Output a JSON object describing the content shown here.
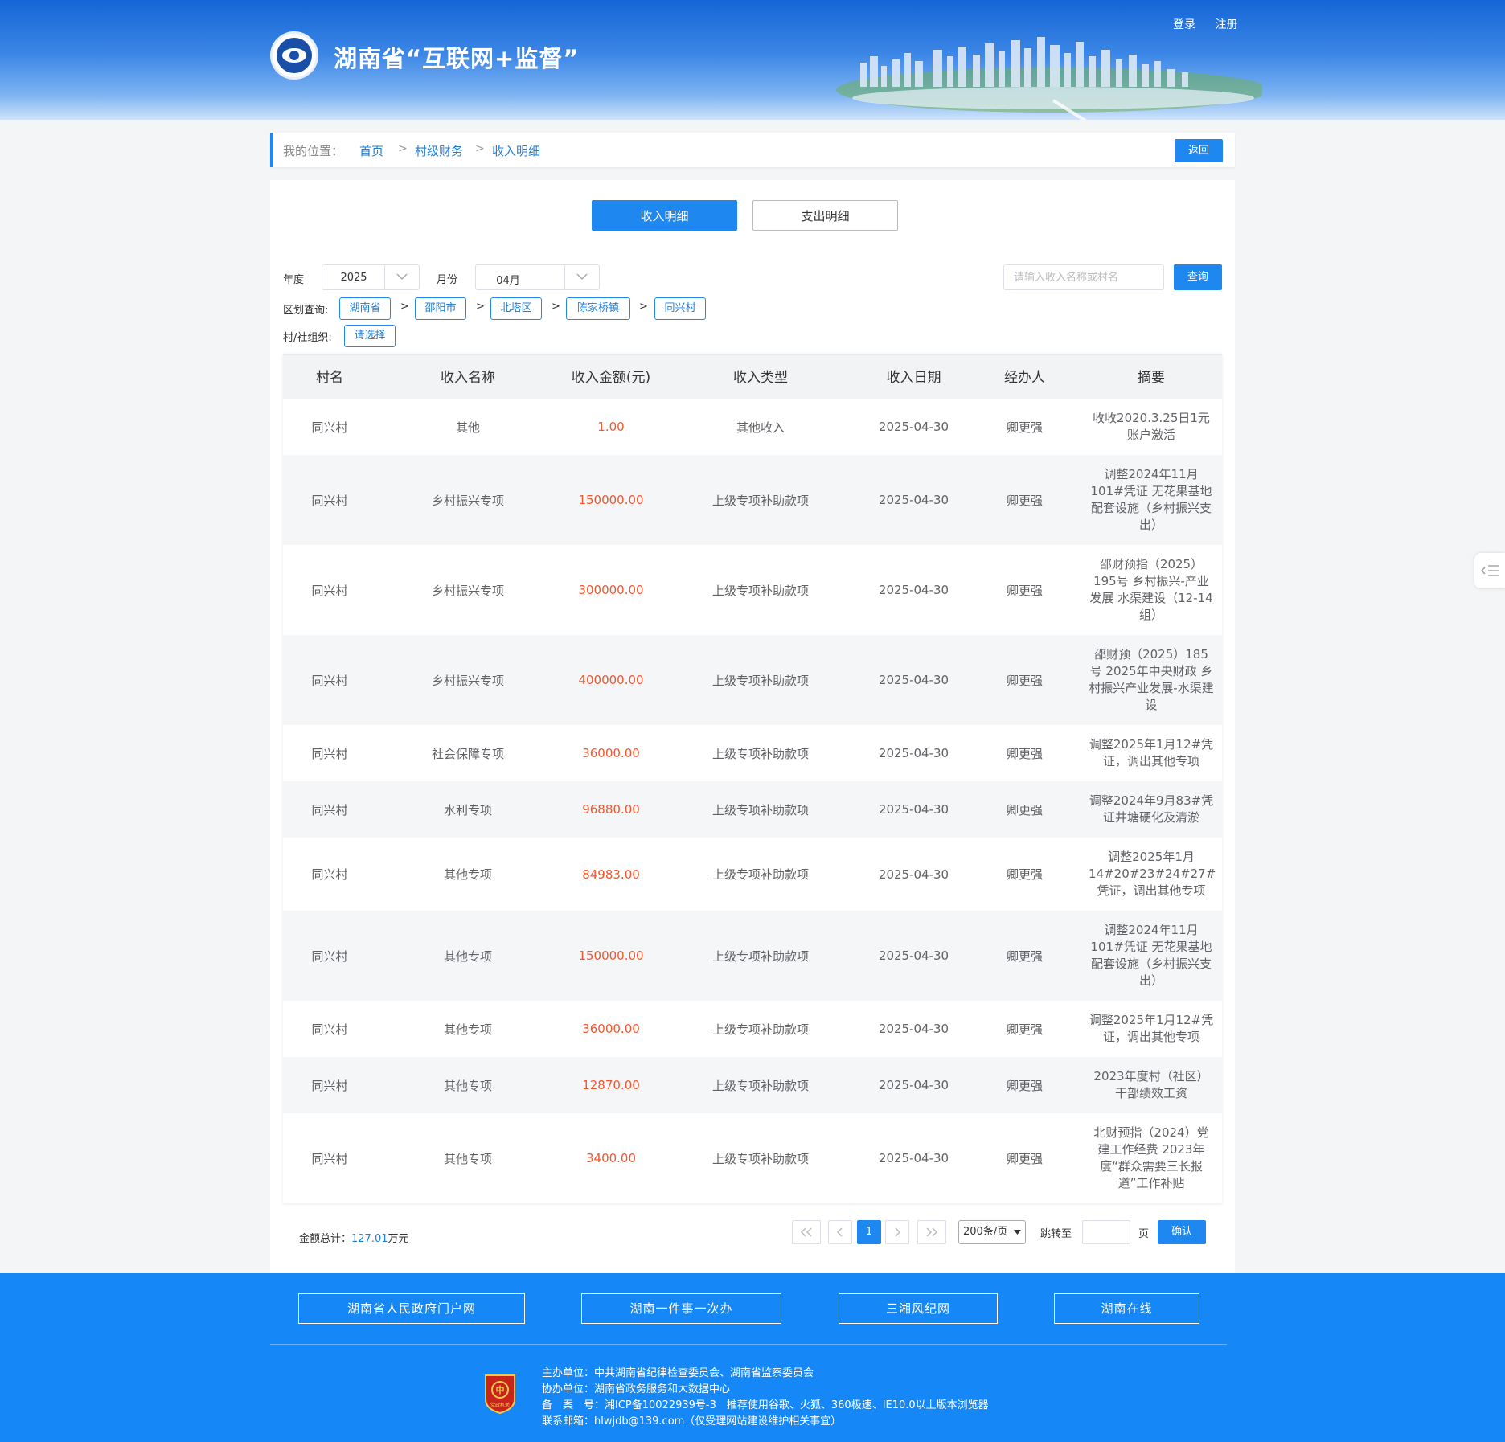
{
  "header": {
    "site_title": "湖南省“互联网+监督”",
    "login": "登录",
    "register": "注册"
  },
  "breadcrumb": {
    "label": "我的位置：",
    "items": [
      "首页",
      "村级财务",
      "收入明细"
    ],
    "separator": ">",
    "back_label": "返回"
  },
  "tabs": [
    {
      "label": "收入明细",
      "active": true
    },
    {
      "label": "支出明细",
      "active": false
    }
  ],
  "filters": {
    "year_label": "年度",
    "year_value": "2025",
    "month_label": "月份",
    "month_value": "04月",
    "search_placeholder": "请输入收入名称或村名",
    "query_label": "查询",
    "region_label": "区划查询:",
    "regions": [
      "湖南省",
      "邵阳市",
      "北塔区",
      "陈家桥镇",
      "同兴村"
    ],
    "region_separator": ">",
    "org_label": "村/社组织:",
    "org_value": "请选择"
  },
  "table": {
    "headers": [
      "村名",
      "收入名称",
      "收入金额(元)",
      "收入类型",
      "收入日期",
      "经办人",
      "摘要"
    ],
    "rows": [
      {
        "village": "同兴村",
        "name": "其他",
        "amount": "1.00",
        "type": "其他收入",
        "date": "2025-04-30",
        "handler": "卿更强",
        "summary": "收收2020.3.25日1元账户激活"
      },
      {
        "village": "同兴村",
        "name": "乡村振兴专项",
        "amount": "150000.00",
        "type": "上级专项补助款项",
        "date": "2025-04-30",
        "handler": "卿更强",
        "summary": "调整2024年11月101#凭证 无花果基地配套设施（乡村振兴支出）"
      },
      {
        "village": "同兴村",
        "name": "乡村振兴专项",
        "amount": "300000.00",
        "type": "上级专项补助款项",
        "date": "2025-04-30",
        "handler": "卿更强",
        "summary": "邵财预指（2025）195号 乡村振兴-产业发展 水渠建设（12-14组）"
      },
      {
        "village": "同兴村",
        "name": "乡村振兴专项",
        "amount": "400000.00",
        "type": "上级专项补助款项",
        "date": "2025-04-30",
        "handler": "卿更强",
        "summary": "邵财预（2025）185号 2025年中央财政 乡村振兴产业发展-水渠建设"
      },
      {
        "village": "同兴村",
        "name": "社会保障专项",
        "amount": "36000.00",
        "type": "上级专项补助款项",
        "date": "2025-04-30",
        "handler": "卿更强",
        "summary": "调整2025年1月12#凭证，调出其他专项"
      },
      {
        "village": "同兴村",
        "name": "水利专项",
        "amount": "96880.00",
        "type": "上级专项补助款项",
        "date": "2025-04-30",
        "handler": "卿更强",
        "summary": "调整2024年9月83#凭证井塘硬化及清淤"
      },
      {
        "village": "同兴村",
        "name": "其他专项",
        "amount": "84983.00",
        "type": "上级专项补助款项",
        "date": "2025-04-30",
        "handler": "卿更强",
        "summary": "调整2025年1月14#20#23#24#27#凭证，调出其他专项"
      },
      {
        "village": "同兴村",
        "name": "其他专项",
        "amount": "150000.00",
        "type": "上级专项补助款项",
        "date": "2025-04-30",
        "handler": "卿更强",
        "summary": "调整2024年11月101#凭证 无花果基地配套设施（乡村振兴支出）"
      },
      {
        "village": "同兴村",
        "name": "其他专项",
        "amount": "36000.00",
        "type": "上级专项补助款项",
        "date": "2025-04-30",
        "handler": "卿更强",
        "summary": "调整2025年1月12#凭证，调出其他专项"
      },
      {
        "village": "同兴村",
        "name": "其他专项",
        "amount": "12870.00",
        "type": "上级专项补助款项",
        "date": "2025-04-30",
        "handler": "卿更强",
        "summary": "2023年度村（社区）干部绩效工资"
      },
      {
        "village": "同兴村",
        "name": "其他专项",
        "amount": "3400.00",
        "type": "上级专项补助款项",
        "date": "2025-04-30",
        "handler": "卿更强",
        "summary": "北财预指（2024）党建工作经费 2023年度“群众需要三长报道”工作补贴"
      }
    ]
  },
  "footer_total": {
    "label": "金额总计：",
    "value": "127.01",
    "unit": "万元"
  },
  "pagination": {
    "current_page": "1",
    "page_size": "200条/页",
    "jump_label": "跳转至",
    "page_unit": "页",
    "confirm_label": "确认"
  },
  "footer": {
    "links": [
      "湖南省人民政府门户网",
      "湖南一件事一次办",
      "三湘风纪网",
      "湖南在线"
    ],
    "info": [
      "主办单位：中共湖南省纪律检查委员会、湖南省监察委员会",
      "协办单位：湖南省政务服务和大数据中心",
      "备　案　号：湘ICP备10022939号-3　推荐使用谷歌、火狐、360极速、IE10.0以上版本浏览器",
      "联系邮箱：hlwjdb@139.com（仅受理网站建设维护相关事宜）"
    ],
    "badge_text": "党政机关"
  },
  "colors": {
    "primary": "#1e88f0",
    "amount": "#f4572d",
    "footer_bg": "#1687f6"
  }
}
